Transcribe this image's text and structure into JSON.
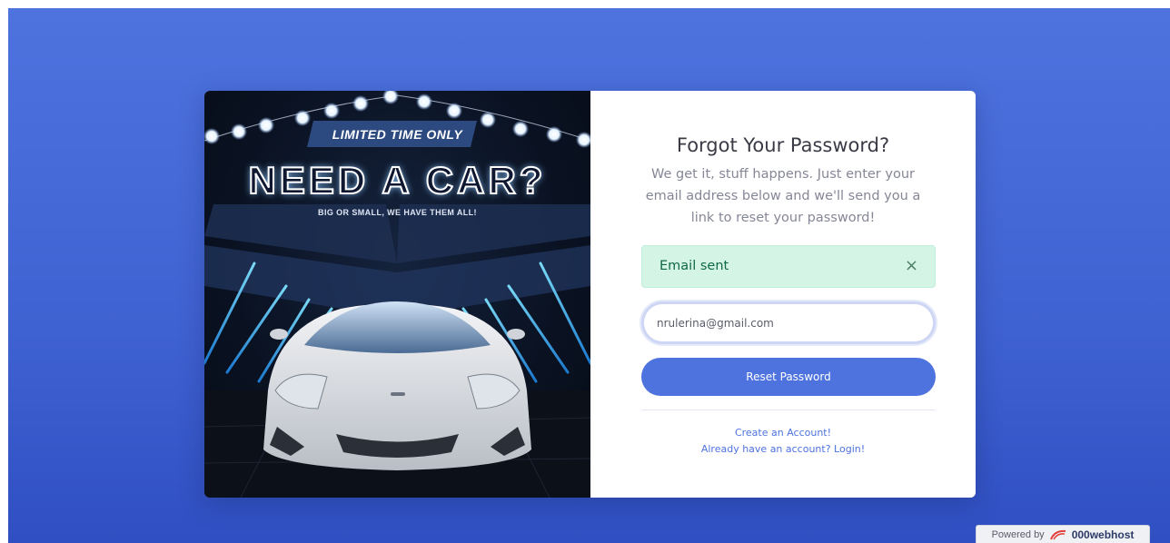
{
  "promo": {
    "badge": "LIMITED TIME ONLY",
    "headline": "NEED A CAR?",
    "tagline": "BIG OR SMALL, WE HAVE THEM ALL!"
  },
  "form": {
    "title": "Forgot Your Password?",
    "subtitle": "We get it, stuff happens. Just enter your email address below and we'll send you a link to reset your password!",
    "alert_text": "Email sent",
    "alert_close": "×",
    "email_value": "nrulerina@gmail.com",
    "reset_label": "Reset Password",
    "create_account": "Create an Account!",
    "login_link": "Already have an account? Login!"
  },
  "footer": {
    "powered_by": "Powered by",
    "brand": "000webhost"
  },
  "colors": {
    "primary": "#4e73df",
    "alert_bg": "#d4f5e6",
    "alert_text": "#0f6848"
  }
}
